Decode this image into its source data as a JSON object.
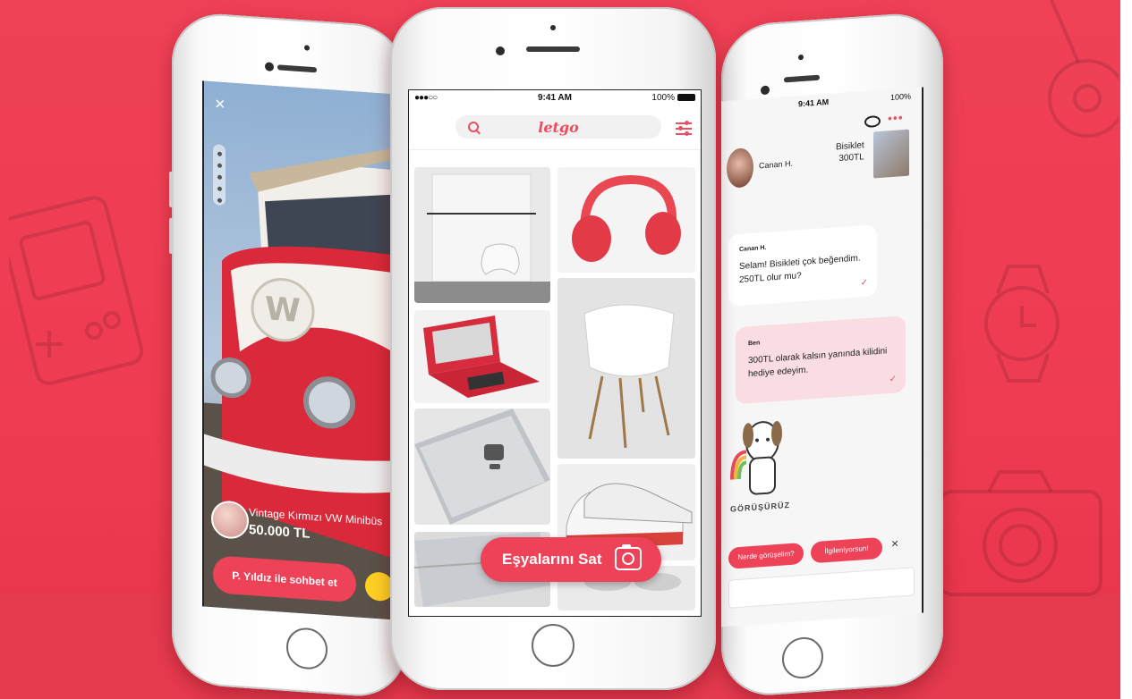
{
  "colors": {
    "accent": "#ee4258",
    "background": "#f04157"
  },
  "center_phone": {
    "status": {
      "signal": "●●●○○",
      "time": "9:41 AM",
      "battery": "100%"
    },
    "logo": "letgo",
    "sell_button": "Eşyalarını Sat",
    "grid_items": [
      "game-console",
      "headphones",
      "handheld-console",
      "chair",
      "smartphone",
      "sneakers",
      "laptop",
      "sunglasses"
    ]
  },
  "left_phone": {
    "close": "×",
    "listing_title": "Vintage Kırmızı VW Minibüs",
    "listing_price": "50.000 TL",
    "chat_button": "P. Yıldız ile sohbet et"
  },
  "right_phone": {
    "status": {
      "time": "9:41 AM",
      "battery": "100%"
    },
    "more": "•••",
    "user_name": "Canan H.",
    "product_name": "Bisiklet",
    "product_price": "300TL",
    "messages": [
      {
        "sender": "Canan H.",
        "text": "Selam! Bisikleti çok beğendim. 250TL olur mu?",
        "tick": "✓"
      },
      {
        "sender": "Ben",
        "text": "300TL olarak kalsın yanında kilidini hediye edeyim.",
        "tick": "✓"
      }
    ],
    "sticker_text": "GÖRÜŞÜRÜZ",
    "quick_replies": [
      "Nerde görüşelim?",
      "İlgileniyorsun!"
    ],
    "dismiss": "×"
  }
}
